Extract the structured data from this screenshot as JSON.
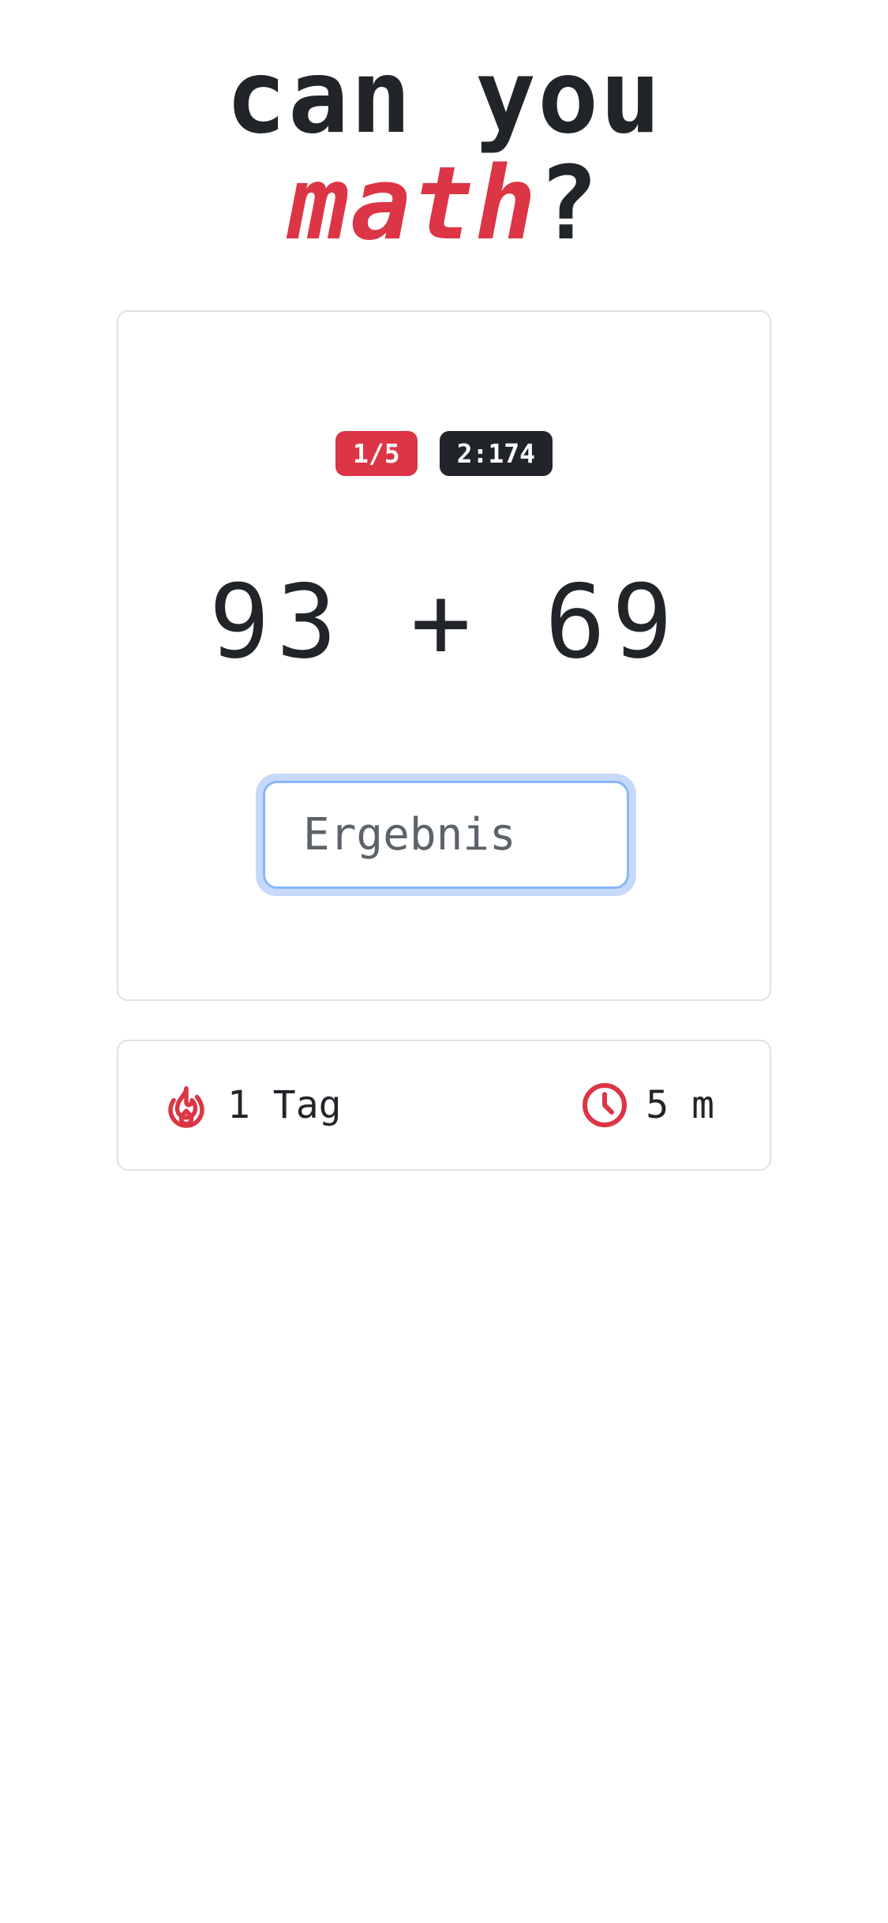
{
  "title": {
    "line1": "can you",
    "accent": "math",
    "suffix": "?"
  },
  "game": {
    "progress_badge": "1/5",
    "timer_badge": "2:174",
    "problem": "93 + 69",
    "answer": {
      "value": "",
      "placeholder": "Ergebnis"
    }
  },
  "stats": {
    "streak": {
      "icon": "flame-icon",
      "text": "1 Tag"
    },
    "time": {
      "icon": "clock-icon",
      "text": "5 m"
    }
  },
  "colors": {
    "accent": "#dc3545",
    "dark": "#212529",
    "focus_ring": "#86b7fe",
    "border": "#dee2e6"
  }
}
